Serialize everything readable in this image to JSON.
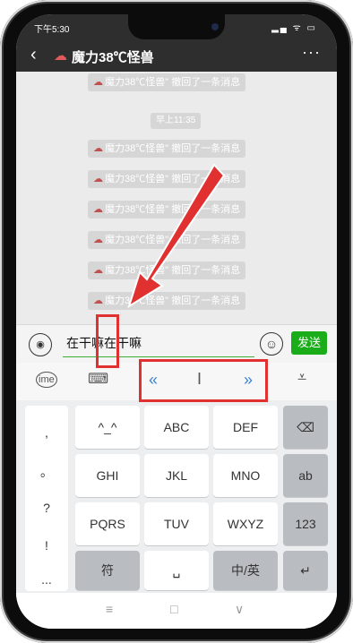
{
  "status": {
    "time": "下午5:30",
    "icons": "▂▄ ᯤ ▭"
  },
  "header": {
    "back": "‹",
    "avatar_icon": "☁",
    "title": "魔力38℃怪兽",
    "more": "···"
  },
  "chat": {
    "recall_icon": "☁",
    "recall_text": "魔力38℃怪兽\" 撤回了一条消息",
    "timestamp": "早上11:35",
    "messages": [
      "魔力38℃怪兽\" 撤回了一条消息",
      "魔力38℃怪兽\" 撤回了一条消息",
      "魔力38℃怪兽\" 撤回了一条消息",
      "魔力38℃怪兽\" 撤回了一条消息",
      "魔力38℃怪兽\" 撤回了一条消息",
      "魔力38℃怪兽\" 撤回了一条消息"
    ]
  },
  "input": {
    "voice_icon": "◉",
    "text": "在干嘛在干嘛",
    "emoji_icon": "☺",
    "send_label": "发送"
  },
  "kb_toolbar": {
    "ime_icon": "ime",
    "keyboard_icon": "⌨",
    "left_arrow": "«",
    "cursor_icon": "I",
    "right_arrow": "»",
    "hide_icon": "⩡"
  },
  "keyboard": {
    "punct": [
      ",",
      "。",
      "?",
      "!",
      "..."
    ],
    "row1": [
      "^_^",
      "ABC",
      "DEF",
      "⌫"
    ],
    "row2": [
      "GHI",
      "JKL",
      "MNO",
      "ab"
    ],
    "row3": [
      "PQRS",
      "TUV",
      "WXYZ",
      "123"
    ],
    "row4": [
      "符",
      "␣",
      "中/英",
      "↵"
    ]
  },
  "navbar": {
    "menu": "≡",
    "home": "□",
    "back": "∨"
  }
}
